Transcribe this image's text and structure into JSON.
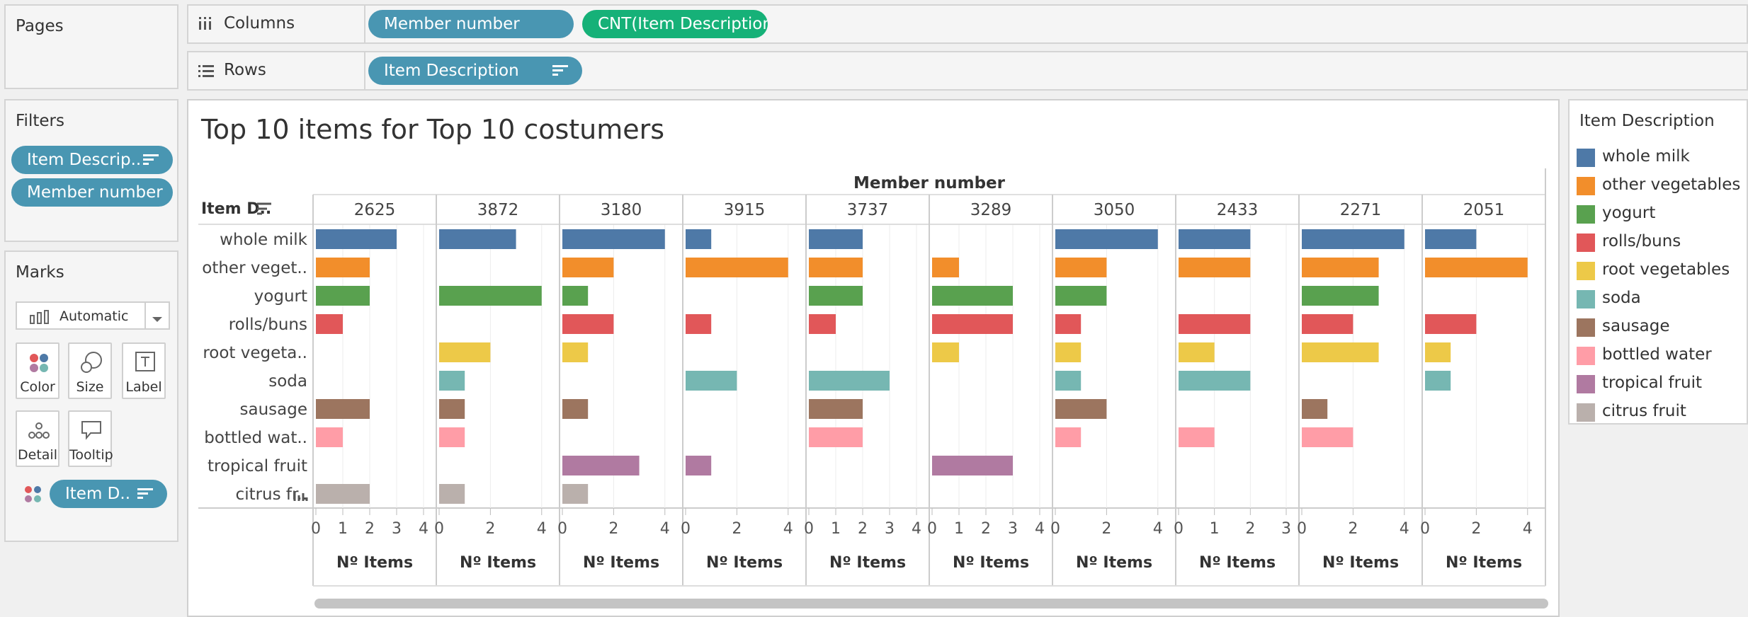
{
  "pages": {
    "title": "Pages"
  },
  "columns_shelf": {
    "label": "Columns",
    "pills": [
      "Member number",
      "CNT(Item Description)"
    ]
  },
  "rows_shelf": {
    "label": "Rows",
    "pills": [
      "Item Description"
    ]
  },
  "filters": {
    "title": "Filters",
    "pills": [
      "Item Descrip..",
      "Member number"
    ]
  },
  "marks": {
    "title": "Marks",
    "type": "Automatic",
    "buttons": [
      "Color",
      "Size",
      "Label",
      "Detail",
      "Tooltip"
    ],
    "color_pill": "Item D.."
  },
  "legend": {
    "title": "Item Description",
    "items": [
      {
        "label": "whole milk",
        "color": "#4e79a7"
      },
      {
        "label": "other vegetables",
        "color": "#f28e2b"
      },
      {
        "label": "yogurt",
        "color": "#59a14f"
      },
      {
        "label": "rolls/buns",
        "color": "#e15759"
      },
      {
        "label": "root vegetables",
        "color": "#edc948"
      },
      {
        "label": "soda",
        "color": "#76b7b2"
      },
      {
        "label": "sausage",
        "color": "#9c755f"
      },
      {
        "label": "bottled water",
        "color": "#ff9da7"
      },
      {
        "label": "tropical fruit",
        "color": "#b07aa1"
      },
      {
        "label": "citrus fruit",
        "color": "#bab0ac"
      }
    ]
  },
  "chart_data": {
    "type": "bar",
    "title": "Top 10 items for Top 10 costumers",
    "column_header": "Member number",
    "row_header": "Item D..",
    "row_labels": [
      "whole milk",
      "other veget..",
      "yogurt",
      "rolls/buns",
      "root vegeta..",
      "soda",
      "sausage",
      "bottled wat..",
      "tropical fruit",
      "citrus fr.."
    ],
    "xlabel": "Nº Items",
    "panes": [
      {
        "member": "2625",
        "ticks": [
          0,
          1,
          2,
          3,
          4
        ],
        "max": 4,
        "values": [
          3,
          2,
          2,
          1,
          0,
          0,
          2,
          1,
          0,
          2
        ]
      },
      {
        "member": "3872",
        "ticks": [
          0,
          2,
          4
        ],
        "max": 4.2,
        "values": [
          3,
          0,
          4,
          0,
          2,
          1,
          1,
          1,
          0,
          1
        ]
      },
      {
        "member": "3180",
        "ticks": [
          0,
          2,
          4
        ],
        "max": 4.2,
        "values": [
          4,
          2,
          1,
          2,
          1,
          0,
          1,
          0,
          3,
          1
        ]
      },
      {
        "member": "3915",
        "ticks": [
          0,
          2,
          4
        ],
        "max": 4.2,
        "values": [
          1,
          4,
          0,
          1,
          0,
          2,
          0,
          0,
          1,
          0
        ]
      },
      {
        "member": "3737",
        "ticks": [
          0,
          1,
          2,
          3,
          4
        ],
        "max": 4,
        "values": [
          2,
          2,
          2,
          1,
          0,
          3,
          2,
          2,
          0,
          0
        ]
      },
      {
        "member": "3289",
        "ticks": [
          0,
          1,
          2,
          3,
          4
        ],
        "max": 4,
        "values": [
          0,
          1,
          3,
          3,
          1,
          0,
          0,
          0,
          3,
          0
        ]
      },
      {
        "member": "3050",
        "ticks": [
          0,
          2,
          4
        ],
        "max": 4.2,
        "values": [
          4,
          2,
          2,
          1,
          1,
          1,
          2,
          1,
          0,
          0
        ]
      },
      {
        "member": "2433",
        "ticks": [
          0,
          1,
          2,
          3
        ],
        "max": 3,
        "values": [
          2,
          2,
          0,
          2,
          1,
          2,
          0,
          1,
          0,
          0
        ]
      },
      {
        "member": "2271",
        "ticks": [
          0,
          2,
          4
        ],
        "max": 4.2,
        "values": [
          4,
          3,
          3,
          2,
          3,
          0,
          1,
          2,
          0,
          0
        ]
      },
      {
        "member": "2051",
        "ticks": [
          0,
          2,
          4
        ],
        "max": 4.2,
        "values": [
          2,
          4,
          0,
          2,
          1,
          1,
          0,
          0,
          0,
          0
        ]
      }
    ]
  }
}
